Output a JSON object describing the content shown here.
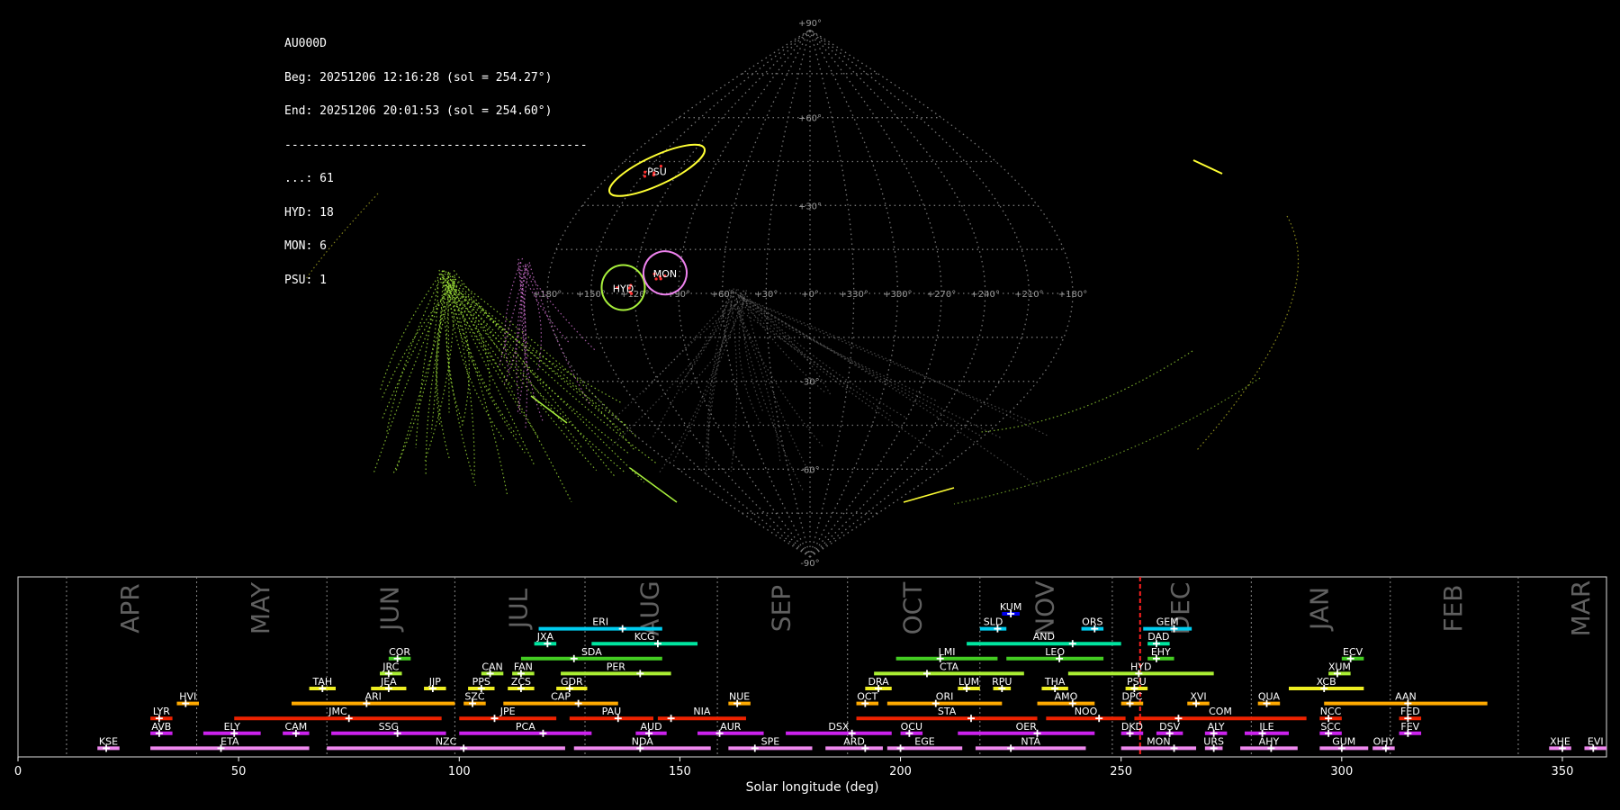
{
  "stats": {
    "station": "AU000D",
    "beg": "Beg: 20251206 12:16:28 (sol = 254.27°)",
    "end": "End: 20251206 20:01:53 (sol = 254.60°)",
    "separator": "-------------------------------------------",
    "counts": [
      "...: 61",
      "HYD: 18",
      "MON: 6",
      "PSU: 1"
    ]
  },
  "colors": {
    "background": "#000000",
    "grid": "#8a8a8a",
    "HYD": "#a8f03c",
    "MON": "#ee82ee",
    "PSU": "#ffff33",
    "sporadic": "#9a9a9a",
    "current_sol": "#ff2020"
  },
  "chart_data": [
    {
      "type": "scatter",
      "projection": "sinusoidal (all-sky radiant map)",
      "x_ticks": [
        "+180°",
        "+150°",
        "+120°",
        "+90°",
        "+60°",
        "+30°",
        "+0°",
        "+330°",
        "+300°",
        "+270°",
        "+240°",
        "+210°",
        "+180°"
      ],
      "y_ticks": [
        "+90°",
        "+60°",
        "+30°",
        "-30°",
        "-60°",
        "-90°"
      ],
      "radiants": [
        {
          "label": "PSU",
          "lon": 141,
          "lat": 42,
          "color": "PSU"
        },
        {
          "label": "HYD",
          "lon": 128,
          "lat": 2,
          "color": "HYD"
        },
        {
          "label": "MON",
          "lon": 100,
          "lat": 7,
          "color": "MON"
        }
      ]
    },
    {
      "type": "timeline",
      "xlabel": "Solar longitude (deg)",
      "xlim": [
        0,
        360
      ],
      "x_ticks": [
        0,
        50,
        100,
        150,
        200,
        250,
        300,
        350
      ],
      "current_sol": 254.3,
      "months": [
        {
          "name": "APR",
          "start": 11
        },
        {
          "name": "MAY",
          "start": 40.5
        },
        {
          "name": "JUN",
          "start": 70
        },
        {
          "name": "JUL",
          "start": 99
        },
        {
          "name": "AUG",
          "start": 128.5
        },
        {
          "name": "SEP",
          "start": 158.5
        },
        {
          "name": "OCT",
          "start": 188
        },
        {
          "name": "NOV",
          "start": 218
        },
        {
          "name": "DEC",
          "start": 248
        },
        {
          "name": "JAN",
          "start": 279.5
        },
        {
          "name": "FEB",
          "start": 311
        },
        {
          "name": "MAR",
          "start": 340
        }
      ],
      "showers": [
        {
          "code": "KUM",
          "start": 223,
          "end": 227,
          "peak": 225,
          "row": 0,
          "color": "#0000ee"
        },
        {
          "code": "ERI",
          "start": 118,
          "end": 146,
          "peak": 137,
          "row": 1,
          "color": "#00ccee"
        },
        {
          "code": "SLD",
          "start": 218,
          "end": 224,
          "peak": 222,
          "row": 1,
          "color": "#00ccee"
        },
        {
          "code": "ORS",
          "start": 241,
          "end": 246,
          "peak": 244,
          "row": 1,
          "color": "#00ccee"
        },
        {
          "code": "GEM",
          "start": 255,
          "end": 266,
          "peak": 262,
          "row": 1,
          "color": "#00ccee"
        },
        {
          "code": "JXA",
          "start": 117,
          "end": 122,
          "peak": 120,
          "row": 2,
          "color": "#00e6a0"
        },
        {
          "code": "KCG",
          "start": 130,
          "end": 154,
          "peak": 145,
          "row": 2,
          "color": "#00e6a0"
        },
        {
          "code": "AND",
          "start": 215,
          "end": 250,
          "peak": 239,
          "row": 2,
          "color": "#00e6a0"
        },
        {
          "code": "DAD",
          "start": 256,
          "end": 261,
          "peak": 258,
          "row": 2,
          "color": "#00e6a0"
        },
        {
          "code": "COR",
          "start": 84,
          "end": 89,
          "peak": 86,
          "row": 3,
          "color": "#44cc22"
        },
        {
          "code": "SDA",
          "start": 114,
          "end": 146,
          "peak": 126,
          "row": 3,
          "color": "#44cc22"
        },
        {
          "code": "LMI",
          "start": 199,
          "end": 222,
          "peak": 209,
          "row": 3,
          "color": "#44cc22"
        },
        {
          "code": "LEO",
          "start": 224,
          "end": 246,
          "peak": 236,
          "row": 3,
          "color": "#44cc22"
        },
        {
          "code": "EHY",
          "start": 256,
          "end": 262,
          "peak": 258,
          "row": 3,
          "color": "#44cc22"
        },
        {
          "code": "ECV",
          "start": 300,
          "end": 305,
          "peak": 302,
          "row": 3,
          "color": "#44cc22"
        },
        {
          "code": "JRC",
          "start": 82,
          "end": 87,
          "peak": 84,
          "row": 4,
          "color": "#aaee33"
        },
        {
          "code": "CAN",
          "start": 105,
          "end": 110,
          "peak": 107,
          "row": 4,
          "color": "#aaee33"
        },
        {
          "code": "FAN",
          "start": 112,
          "end": 117,
          "peak": 114,
          "row": 4,
          "color": "#aaee33"
        },
        {
          "code": "PER",
          "start": 123,
          "end": 148,
          "peak": 141,
          "row": 4,
          "color": "#aaee33"
        },
        {
          "code": "CTA",
          "start": 194,
          "end": 228,
          "peak": 206,
          "row": 4,
          "color": "#aaee33"
        },
        {
          "code": "HYD",
          "start": 238,
          "end": 271,
          "peak": 254,
          "row": 4,
          "color": "#aaee33"
        },
        {
          "code": "XUM",
          "start": 297,
          "end": 302,
          "peak": 299,
          "row": 4,
          "color": "#aaee33"
        },
        {
          "code": "TAH",
          "start": 66,
          "end": 72,
          "peak": 69,
          "row": 5,
          "color": "#eeee22"
        },
        {
          "code": "JEA",
          "start": 80,
          "end": 88,
          "peak": 84,
          "row": 5,
          "color": "#eeee22"
        },
        {
          "code": "JIP",
          "start": 92,
          "end": 97,
          "peak": 94,
          "row": 5,
          "color": "#eeee22"
        },
        {
          "code": "PPS",
          "start": 102,
          "end": 108,
          "peak": 105,
          "row": 5,
          "color": "#eeee22"
        },
        {
          "code": "ZCS",
          "start": 111,
          "end": 117,
          "peak": 114,
          "row": 5,
          "color": "#eeee22"
        },
        {
          "code": "GDR",
          "start": 122,
          "end": 129,
          "peak": 125,
          "row": 5,
          "color": "#eeee22"
        },
        {
          "code": "DRA",
          "start": 192,
          "end": 198,
          "peak": 195,
          "row": 5,
          "color": "#eeee22"
        },
        {
          "code": "LUM",
          "start": 213,
          "end": 218,
          "peak": 215,
          "row": 5,
          "color": "#eeee22"
        },
        {
          "code": "RPU",
          "start": 221,
          "end": 225,
          "peak": 223,
          "row": 5,
          "color": "#eeee22"
        },
        {
          "code": "THA",
          "start": 232,
          "end": 238,
          "peak": 235,
          "row": 5,
          "color": "#eeee22"
        },
        {
          "code": "PSU",
          "start": 251,
          "end": 256,
          "peak": 253,
          "row": 5,
          "color": "#eeee22"
        },
        {
          "code": "XCB",
          "start": 288,
          "end": 305,
          "peak": 296,
          "row": 5,
          "color": "#eeee22"
        },
        {
          "code": "HVI",
          "start": 36,
          "end": 41,
          "peak": 38,
          "row": 6,
          "color": "#ffaa00"
        },
        {
          "code": "ARI",
          "start": 62,
          "end": 99,
          "peak": 79,
          "row": 6,
          "color": "#ffaa00"
        },
        {
          "code": "SZC",
          "start": 101,
          "end": 106,
          "peak": 103,
          "row": 6,
          "color": "#ffaa00"
        },
        {
          "code": "CAP",
          "start": 110,
          "end": 136,
          "peak": 127,
          "row": 6,
          "color": "#ffaa00"
        },
        {
          "code": "NUE",
          "start": 161,
          "end": 166,
          "peak": 163,
          "row": 6,
          "color": "#ffaa00"
        },
        {
          "code": "OCT",
          "start": 190,
          "end": 195,
          "peak": 192,
          "row": 6,
          "color": "#ffaa00"
        },
        {
          "code": "ORI",
          "start": 197,
          "end": 223,
          "peak": 208,
          "row": 6,
          "color": "#ffaa00"
        },
        {
          "code": "AMO",
          "start": 231,
          "end": 244,
          "peak": 239,
          "row": 6,
          "color": "#ffaa00"
        },
        {
          "code": "DPC",
          "start": 250,
          "end": 255,
          "peak": 252,
          "row": 6,
          "color": "#ffaa00"
        },
        {
          "code": "XVI",
          "start": 265,
          "end": 270,
          "peak": 267,
          "row": 6,
          "color": "#ffaa00"
        },
        {
          "code": "QUA",
          "start": 281,
          "end": 286,
          "peak": 283,
          "row": 6,
          "color": "#ffaa00"
        },
        {
          "code": "AAN",
          "start": 296,
          "end": 333,
          "peak": 315,
          "row": 6,
          "color": "#ffaa00"
        },
        {
          "code": "LYR",
          "start": 30,
          "end": 35,
          "peak": 32,
          "row": 7,
          "color": "#ee2200"
        },
        {
          "code": "JMC",
          "start": 49,
          "end": 96,
          "peak": 75,
          "row": 7,
          "color": "#ee2200"
        },
        {
          "code": "JPE",
          "start": 100,
          "end": 122,
          "peak": 108,
          "row": 7,
          "color": "#ee2200"
        },
        {
          "code": "PAU",
          "start": 125,
          "end": 144,
          "peak": 136,
          "row": 7,
          "color": "#ee2200"
        },
        {
          "code": "NIA",
          "start": 145,
          "end": 165,
          "peak": 148,
          "row": 7,
          "color": "#ee2200"
        },
        {
          "code": "STA",
          "start": 190,
          "end": 231,
          "peak": 216,
          "row": 7,
          "color": "#ee2200"
        },
        {
          "code": "NOO",
          "start": 233,
          "end": 251,
          "peak": 245,
          "row": 7,
          "color": "#ee2200"
        },
        {
          "code": "COM",
          "start": 253,
          "end": 292,
          "peak": 263,
          "row": 7,
          "color": "#ee2200"
        },
        {
          "code": "NCC",
          "start": 295,
          "end": 300,
          "peak": 297,
          "row": 7,
          "color": "#ee2200"
        },
        {
          "code": "FED",
          "start": 313,
          "end": 318,
          "peak": 315,
          "row": 7,
          "color": "#ee2200"
        },
        {
          "code": "AVB",
          "start": 30,
          "end": 35,
          "peak": 32,
          "row": 8,
          "color": "#cc22ee"
        },
        {
          "code": "ELY",
          "start": 42,
          "end": 55,
          "peak": 49,
          "row": 8,
          "color": "#cc22ee"
        },
        {
          "code": "CAM",
          "start": 60,
          "end": 66,
          "peak": 63,
          "row": 8,
          "color": "#cc22ee"
        },
        {
          "code": "SSG",
          "start": 71,
          "end": 97,
          "peak": 86,
          "row": 8,
          "color": "#cc22ee"
        },
        {
          "code": "PCA",
          "start": 100,
          "end": 130,
          "peak": 119,
          "row": 8,
          "color": "#cc22ee"
        },
        {
          "code": "AUD",
          "start": 140,
          "end": 147,
          "peak": 143,
          "row": 8,
          "color": "#cc22ee"
        },
        {
          "code": "AUR",
          "start": 154,
          "end": 169,
          "peak": 159,
          "row": 8,
          "color": "#cc22ee"
        },
        {
          "code": "DSX",
          "start": 174,
          "end": 198,
          "peak": 189,
          "row": 8,
          "color": "#cc22ee"
        },
        {
          "code": "OCU",
          "start": 200,
          "end": 205,
          "peak": 202,
          "row": 8,
          "color": "#cc22ee"
        },
        {
          "code": "OER",
          "start": 213,
          "end": 244,
          "peak": 231,
          "row": 8,
          "color": "#cc22ee"
        },
        {
          "code": "DKD",
          "start": 250,
          "end": 255,
          "peak": 252,
          "row": 8,
          "color": "#cc22ee"
        },
        {
          "code": "DSV",
          "start": 258,
          "end": 264,
          "peak": 261,
          "row": 8,
          "color": "#cc22ee"
        },
        {
          "code": "ALY",
          "start": 269,
          "end": 274,
          "peak": 271,
          "row": 8,
          "color": "#cc22ee"
        },
        {
          "code": "ILE",
          "start": 278,
          "end": 288,
          "peak": 282,
          "row": 8,
          "color": "#cc22ee"
        },
        {
          "code": "SCC",
          "start": 295,
          "end": 300,
          "peak": 297,
          "row": 8,
          "color": "#cc22ee"
        },
        {
          "code": "FEV",
          "start": 313,
          "end": 318,
          "peak": 315,
          "row": 8,
          "color": "#cc22ee"
        },
        {
          "code": "KSE",
          "start": 18,
          "end": 23,
          "peak": 20,
          "row": 9,
          "color": "#ee88ee"
        },
        {
          "code": "ETA",
          "start": 30,
          "end": 66,
          "peak": 46,
          "row": 9,
          "color": "#ee88ee"
        },
        {
          "code": "NZC",
          "start": 70,
          "end": 124,
          "peak": 101,
          "row": 9,
          "color": "#ee88ee"
        },
        {
          "code": "NDA",
          "start": 126,
          "end": 157,
          "peak": 141,
          "row": 9,
          "color": "#ee88ee"
        },
        {
          "code": "SPE",
          "start": 161,
          "end": 180,
          "peak": 167,
          "row": 9,
          "color": "#ee88ee"
        },
        {
          "code": "ARD",
          "start": 183,
          "end": 196,
          "peak": 192,
          "row": 9,
          "color": "#ee88ee"
        },
        {
          "code": "EGE",
          "start": 197,
          "end": 214,
          "peak": 200,
          "row": 9,
          "color": "#ee88ee"
        },
        {
          "code": "NTA",
          "start": 217,
          "end": 242,
          "peak": 225,
          "row": 9,
          "color": "#ee88ee"
        },
        {
          "code": "MON",
          "start": 250,
          "end": 267,
          "peak": 262,
          "row": 9,
          "color": "#ee88ee"
        },
        {
          "code": "URS",
          "start": 269,
          "end": 273,
          "peak": 271,
          "row": 9,
          "color": "#ee88ee"
        },
        {
          "code": "AHY",
          "start": 277,
          "end": 290,
          "peak": 284,
          "row": 9,
          "color": "#ee88ee"
        },
        {
          "code": "GUM",
          "start": 295,
          "end": 306,
          "peak": 300,
          "row": 9,
          "color": "#ee88ee"
        },
        {
          "code": "OHY",
          "start": 307,
          "end": 312,
          "peak": 310,
          "row": 9,
          "color": "#ee88ee"
        },
        {
          "code": "XHE",
          "start": 347,
          "end": 352,
          "peak": 350,
          "row": 9,
          "color": "#ee88ee"
        },
        {
          "code": "EVI",
          "start": 355,
          "end": 360,
          "peak": 357,
          "row": 9,
          "color": "#ee88ee"
        }
      ]
    }
  ]
}
